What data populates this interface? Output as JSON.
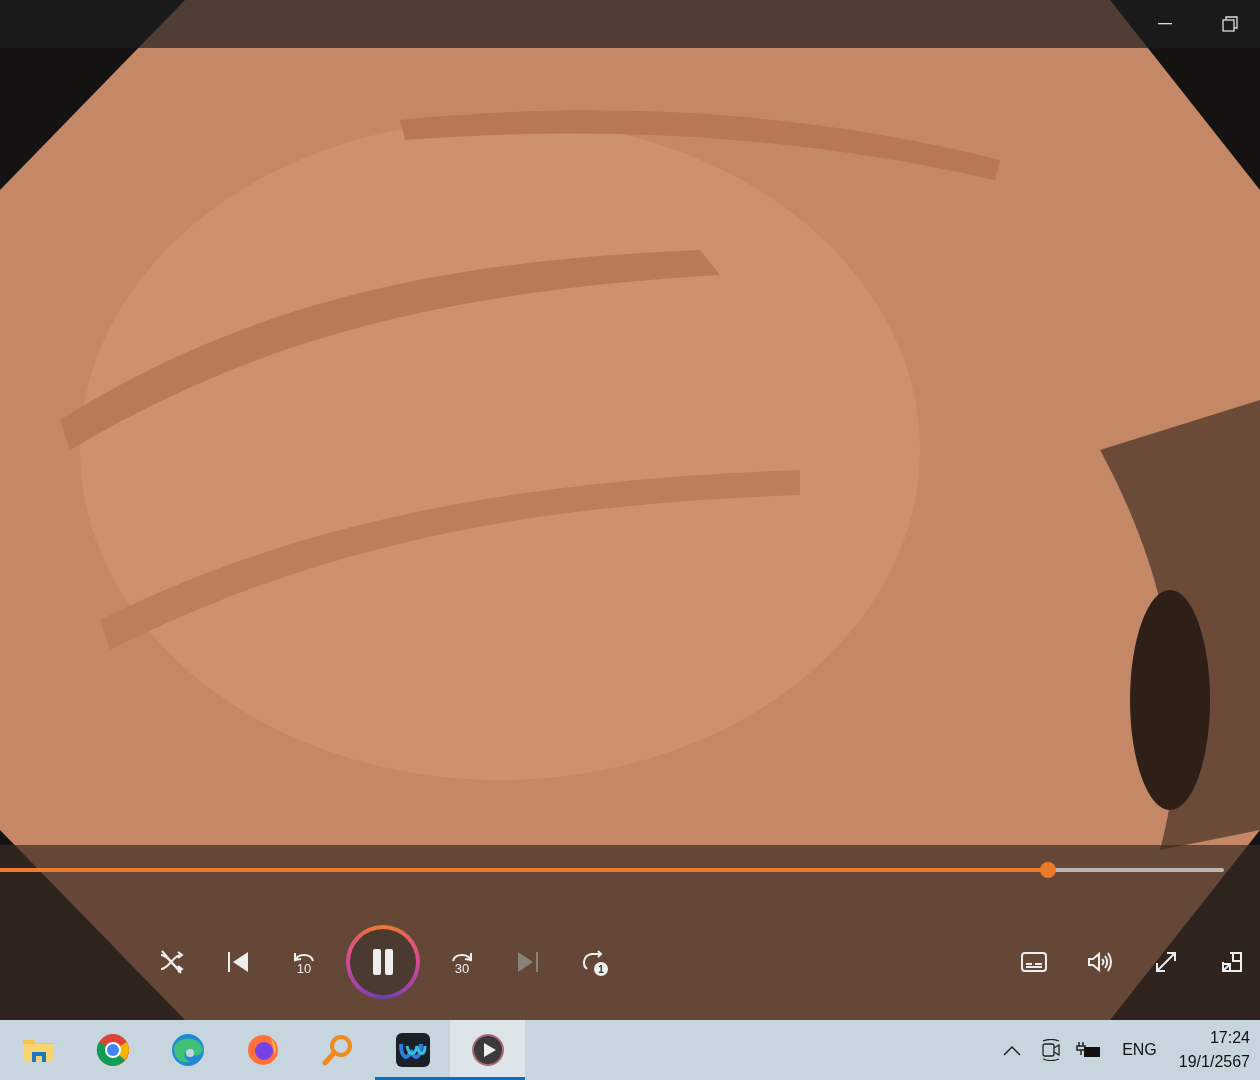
{
  "player": {
    "seek": {
      "level": 0.856
    },
    "playing": true,
    "skip_back_label": "10",
    "skip_forward_label": "30",
    "repeat_badge": "1",
    "shuffle_on": false,
    "next_disabled": true
  },
  "taskbar": {
    "apps": [
      {
        "kind": "folder",
        "running": false,
        "active": false
      },
      {
        "kind": "chrome",
        "running": false,
        "active": false
      },
      {
        "kind": "edge",
        "running": false,
        "active": false
      },
      {
        "kind": "firefox",
        "running": false,
        "active": false
      },
      {
        "kind": "search",
        "running": false,
        "active": false
      },
      {
        "kind": "waves",
        "running": true,
        "active": false
      },
      {
        "kind": "player",
        "running": true,
        "active": true
      }
    ],
    "language": "ENG",
    "time": "17:24",
    "date": "19/1/2567"
  }
}
